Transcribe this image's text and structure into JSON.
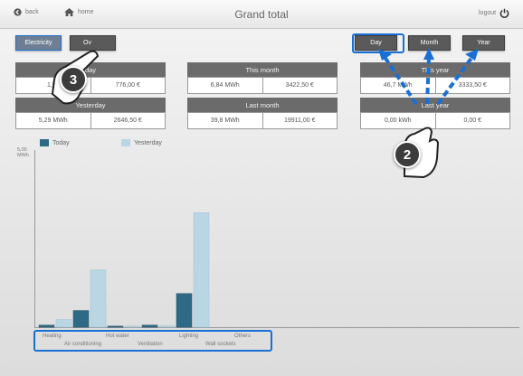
{
  "header": {
    "back_label": "back",
    "home_label": "home",
    "title": "Grand total",
    "logout_label": "logout"
  },
  "view_tabs": {
    "electricity": "Electricity",
    "other": "Ov"
  },
  "period_buttons": {
    "day": "Day",
    "month": "Month",
    "year": "Year"
  },
  "cards": {
    "today": {
      "label": "day",
      "energy": "1,55",
      "cost": "776,00 €"
    },
    "this_month": {
      "label": "This month",
      "energy": "6,84 MWh",
      "cost": "3422,50 €"
    },
    "this_year": {
      "label": "This year",
      "energy": "46,7 MWh",
      "cost": "3333,50 €"
    },
    "yesterday": {
      "label": "Yesterday",
      "energy": "5,29 MWh",
      "cost": "2646,50 €"
    },
    "last_month": {
      "label": "Last month",
      "energy": "39,8 MWh",
      "cost": "19911,00 €"
    },
    "last_year": {
      "label": "Last year",
      "energy": "0,00 kWh",
      "cost": "0,00 €"
    }
  },
  "callouts": {
    "one": "3",
    "two": "2"
  },
  "colors": {
    "today_series": "#2e6a86",
    "yesterday_series": "#b9d6e4",
    "highlight": "#1a6fd4"
  },
  "chart_data": {
    "type": "bar",
    "ylabel": "MWh",
    "y_top_label": "5,00",
    "ylim": [
      0,
      5
    ],
    "categories": [
      "Heating",
      "Air conditioning",
      "Hot water",
      "Ventilation",
      "Lighting",
      "Wall sockets",
      "Others"
    ],
    "series": [
      {
        "name": "Today",
        "values": [
          0.06,
          0.48,
          0.03,
          0.06,
          0.97,
          0.0,
          0.0
        ]
      },
      {
        "name": "Yesterday",
        "values": [
          0.22,
          1.65,
          0.03,
          0.04,
          3.3,
          0.0,
          0.0
        ]
      }
    ]
  }
}
